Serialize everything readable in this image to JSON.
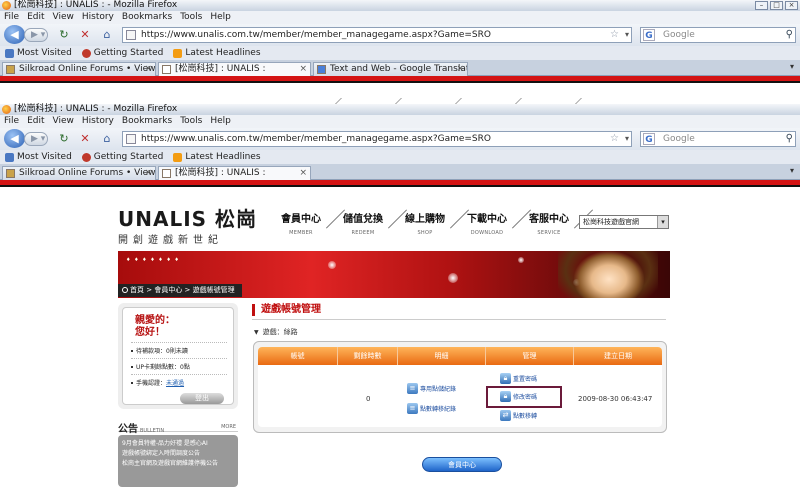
{
  "browser": {
    "title": "[松崗科技] : UNALIS : - Mozilla Firefox",
    "menu": [
      "File",
      "Edit",
      "View",
      "History",
      "Bookmarks",
      "Tools",
      "Help"
    ],
    "url": "https://www.unalis.com.tw/member/member_managegame.aspx?Game=SRO",
    "search_placeholder": "Google",
    "bookmarks": [
      "Most Visited",
      "Getting Started",
      "Latest Headlines"
    ],
    "tabs_top": [
      {
        "label": "Silkroad Online Forums • View topic..."
      },
      {
        "label": "[松崗科技] : UNALIS :"
      },
      {
        "label": "Text and Web - Google Translate"
      }
    ],
    "tabs_bottom": [
      {
        "label": "Silkroad Online Forums • View topic..."
      },
      {
        "label": "[松崗科技] : UNALIS :"
      }
    ]
  },
  "site": {
    "logo": "UNALIS 松崗",
    "slogan": "開創遊戲新世紀",
    "nav": [
      {
        "zh": "會員中心",
        "en": "MEMBER"
      },
      {
        "zh": "儲值兌換",
        "en": "REDEEM"
      },
      {
        "zh": "線上購物",
        "en": "SHOP"
      },
      {
        "zh": "下載中心",
        "en": "DOWNLOAD"
      },
      {
        "zh": "客服中心",
        "en": "SERVICE"
      }
    ],
    "site_select": "松崗科技遊戲官網",
    "breadcrumb": "首頁 > 會員中心 > 遊戲帳號管理"
  },
  "sidebar": {
    "greeting_1": "親愛的：",
    "greeting_2": "您好！",
    "rows": [
      "待補款項：0則未讀",
      "UP卡剩餘點數：0點",
      "手機認證："
    ],
    "phone_status": "未通過",
    "logout": "登出",
    "bulletin_title": "公告",
    "bulletin_en": "BULLETIN",
    "bulletin_more": "MORE",
    "bulletin_items": [
      "9月會員特權-品力好禮 是感心AI",
      "遊戲帳號綁定入時間調度公告",
      "松崗主官網及遊戲官網維護停機公告"
    ]
  },
  "main": {
    "title": "遊戲帳號管理",
    "game_label": "遊戲：絲路",
    "columns": [
      "帳號",
      "剩餘時數",
      "明細",
      "管理",
      "建立日期"
    ],
    "row": {
      "account": "",
      "remaining": "0",
      "details": [
        "專用點儲紀錄",
        "點數轉移紀錄"
      ],
      "manage": [
        "重置密碼",
        "修改密碼",
        "點數移轉"
      ],
      "created": "2009-08-30 06:43:47"
    },
    "member_center_button": "會員中心"
  }
}
